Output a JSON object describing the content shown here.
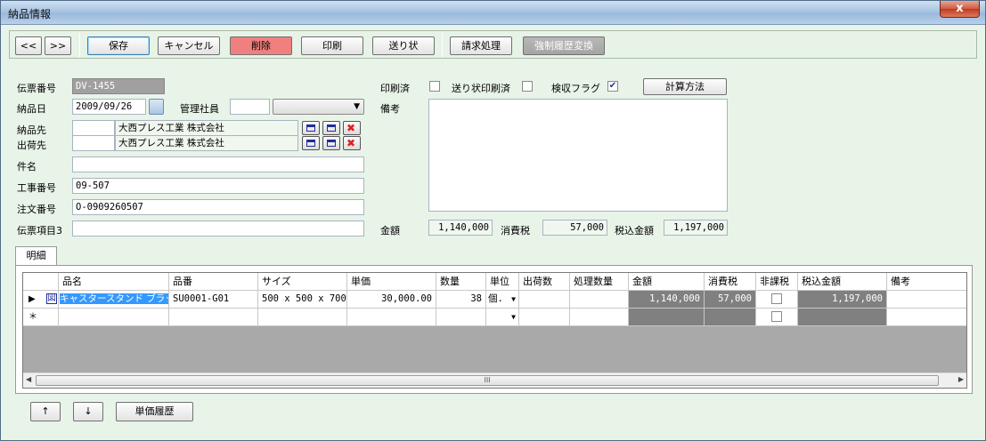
{
  "window": {
    "title": "納品情報",
    "close": "x"
  },
  "toolbar": {
    "prev": "<<",
    "next": ">>",
    "save": "保存",
    "cancel": "キャンセル",
    "delete": "削除",
    "print": "印刷",
    "slip": "送り状",
    "billing": "請求処理",
    "force_history": "強制履歴変換"
  },
  "form": {
    "slip_no_label": "伝票番号",
    "slip_no": "DV-1455",
    "delivery_date_label": "納品日",
    "delivery_date": "2009/09/26",
    "manager_label": "管理社員",
    "manager_code": "",
    "manager_name": "",
    "deliver_to_label": "納品先",
    "deliver_to_code": "",
    "deliver_to_name": "大西プレス工業  株式会社",
    "ship_from_label": "出荷先",
    "ship_from_code": "",
    "ship_from_name": "大西プレス工業  株式会社",
    "subject_label": "件名",
    "subject": "",
    "work_no_label": "工事番号",
    "work_no": "09-507",
    "order_no_label": "注文番号",
    "order_no": "O-0909260507",
    "item3_label": "伝票項目3",
    "item3": "",
    "printed_label": "印刷済",
    "printed": false,
    "slip_printed_label": "送り状印刷済",
    "slip_printed": false,
    "inspected_label": "検収フラグ",
    "inspected": true,
    "calc_method": "計算方法",
    "remarks_label": "備考",
    "remarks": "",
    "amount_label": "金額",
    "amount": "1,140,000",
    "tax_label": "消費税",
    "tax": "57,000",
    "total_label": "税込金額",
    "total": "1,197,000"
  },
  "tab": "明細",
  "grid": {
    "columns": [
      "品名",
      "品番",
      "サイズ",
      "単価",
      "数量",
      "単位",
      "出荷数",
      "処理数量",
      "金額",
      "消費税",
      "非課税",
      "税込金額",
      "備考"
    ],
    "rows": [
      {
        "marker": "▶",
        "badge": "図",
        "name": "キャスタースタンド ブラック",
        "code": "SU0001-G01",
        "size": "500 x 500 x 700",
        "price": "30,000.00",
        "qty": "38",
        "unit": "個.",
        "shipped": "",
        "processed": "",
        "amount": "1,140,000",
        "tax": "57,000",
        "taxfree": false,
        "total": "1,197,000",
        "note": ""
      }
    ],
    "new_row_marker": "＊",
    "scroll_mark": "III"
  },
  "bottom": {
    "up": "↑",
    "down": "↓",
    "price_history": "単価履歴"
  },
  "colors": {
    "background": "#e9f4e9",
    "delete": "#f08080",
    "selection": "#3399ff"
  }
}
